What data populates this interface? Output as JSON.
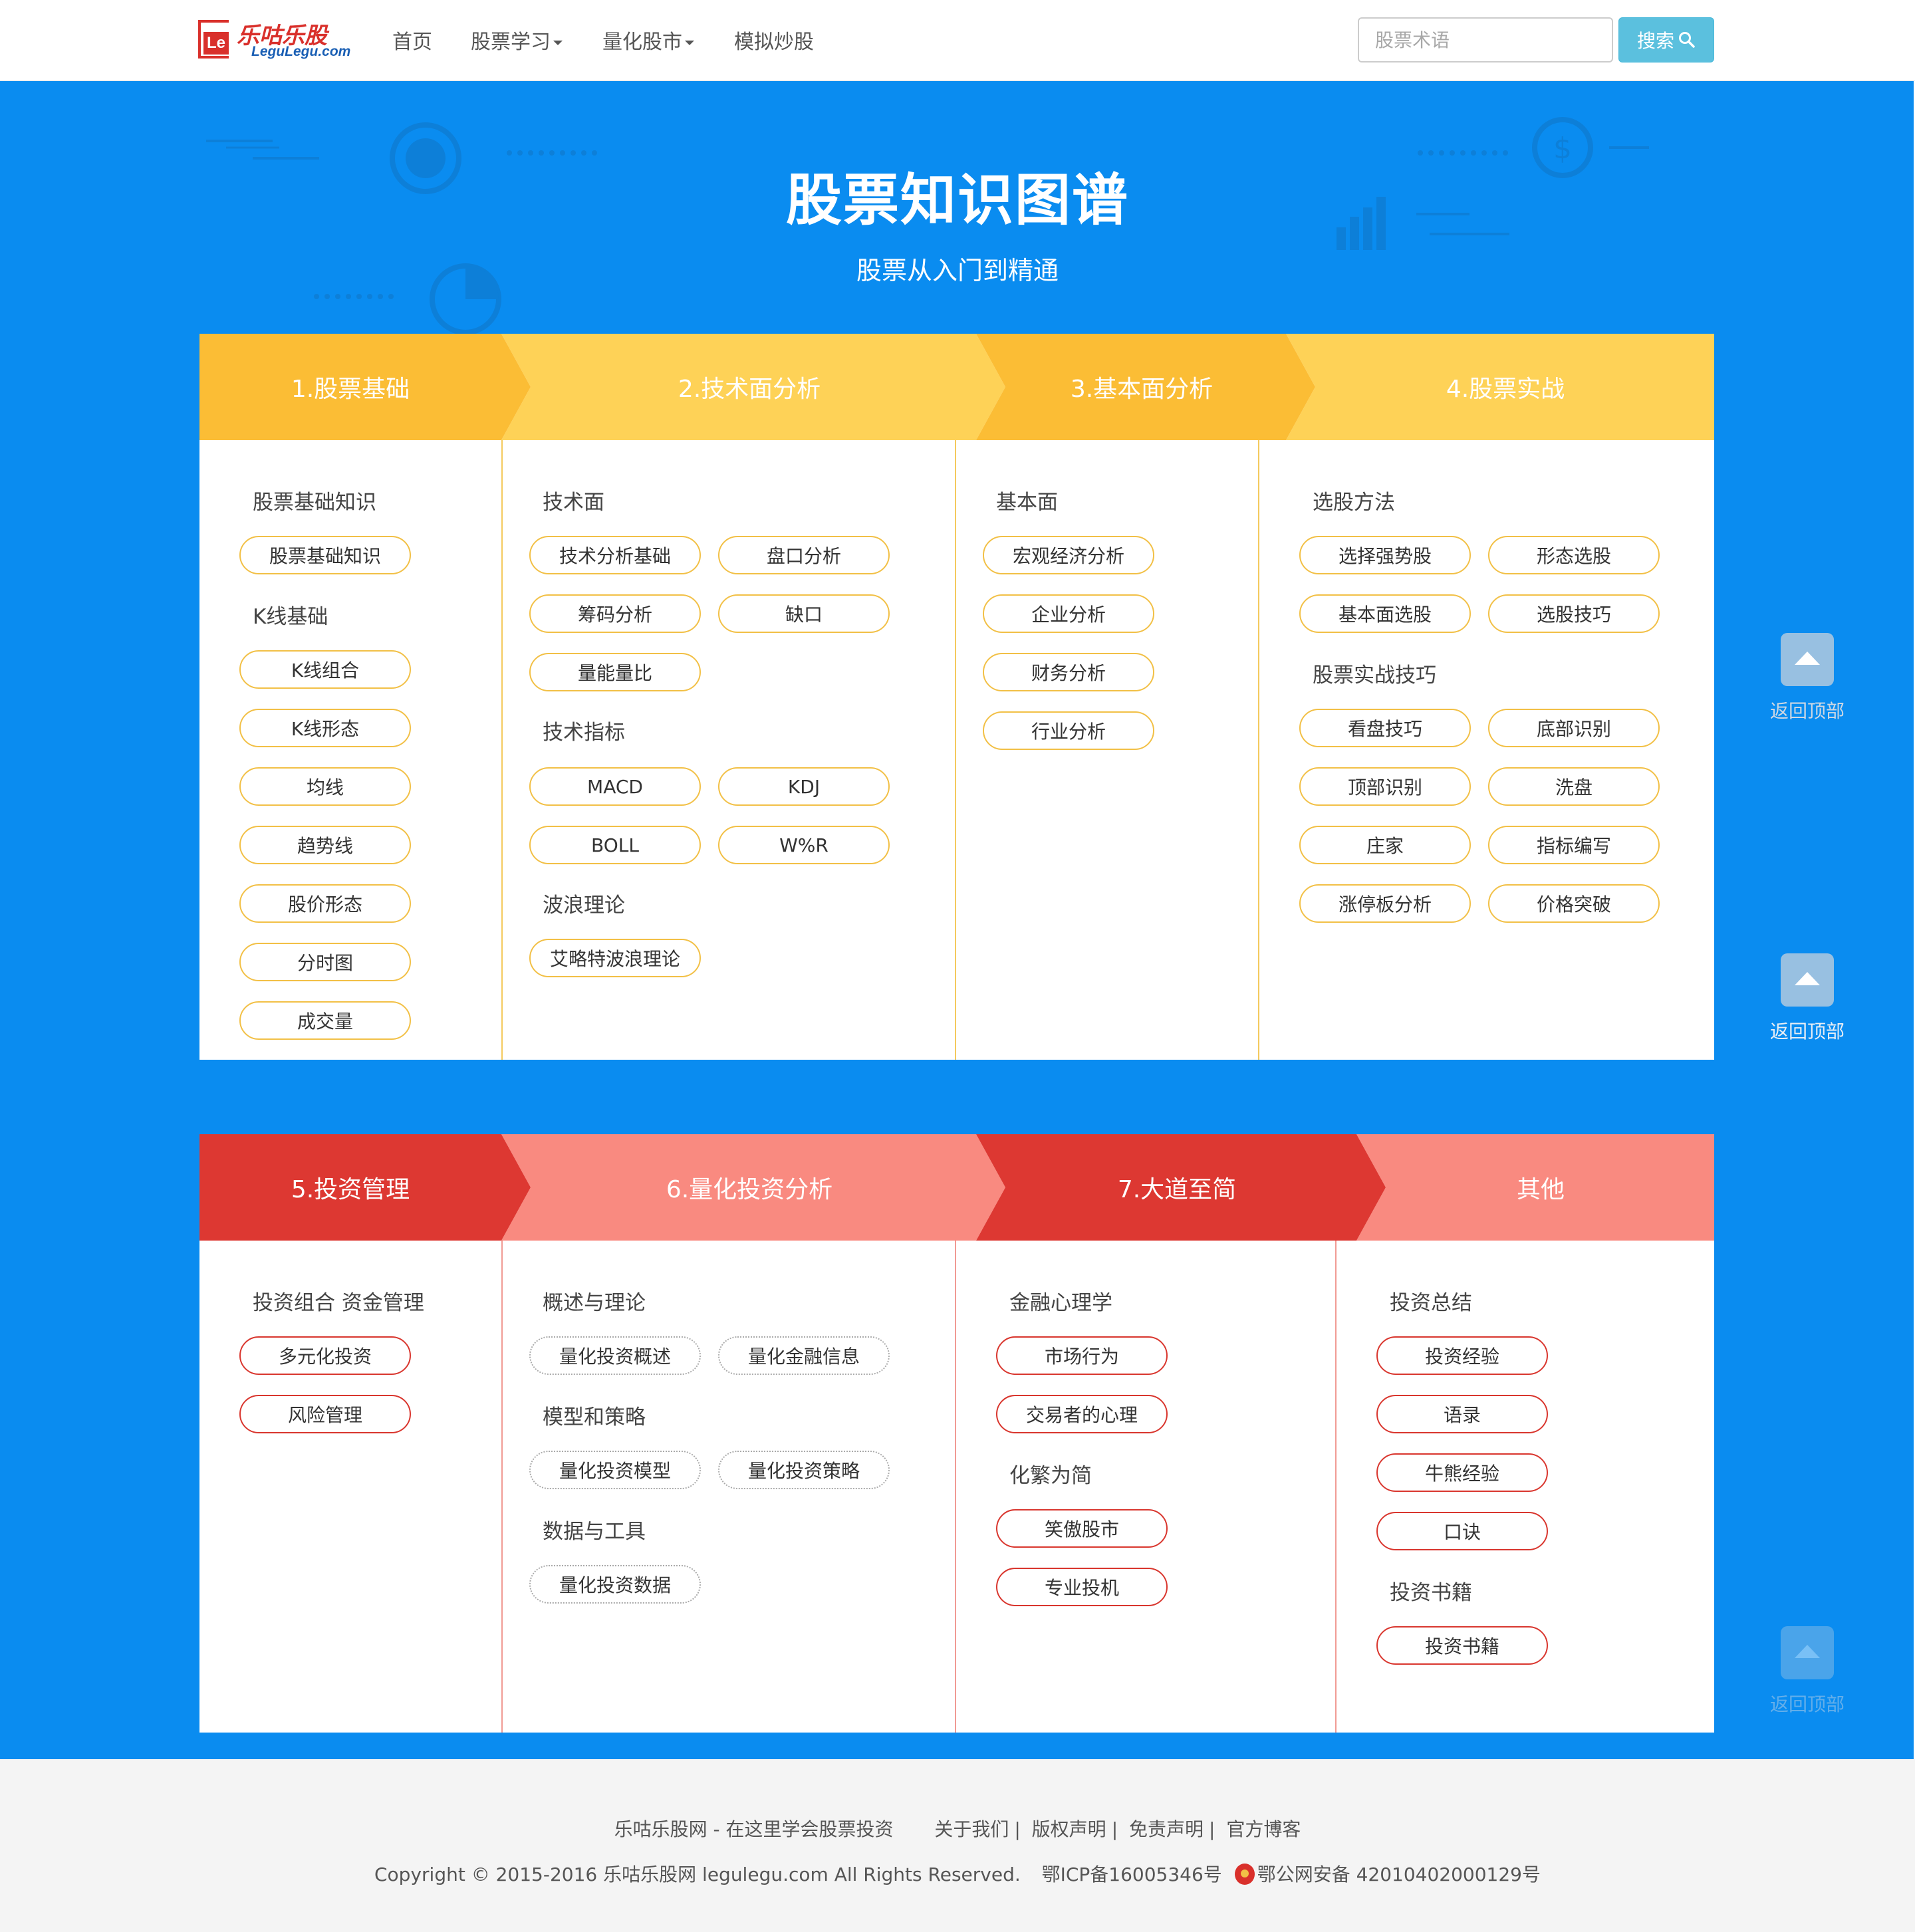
{
  "nav": {
    "logo_title": "乐咕乐股",
    "logo_sub": "LeguLegu.com",
    "logo_mark": "Le",
    "items": [
      {
        "label": "首页",
        "dropdown": false
      },
      {
        "label": "股票学习",
        "dropdown": true
      },
      {
        "label": "量化股市",
        "dropdown": true
      },
      {
        "label": "模拟炒股",
        "dropdown": false
      }
    ],
    "search_placeholder": "股票术语",
    "search_button": "搜索"
  },
  "hero": {
    "title": "股票知识图谱",
    "subtitle": "股票从入门到精通"
  },
  "section1": {
    "headers": [
      "1.股票基础",
      "2.技术面分析",
      "3.基本面分析",
      "4.股票实战"
    ],
    "col1": {
      "cats": [
        "股票基础知识",
        "K线基础"
      ],
      "pills": [
        "股票基础知识",
        "K线组合",
        "K线形态",
        "均线",
        "趋势线",
        "股价形态",
        "分时图",
        "成交量"
      ]
    },
    "col2": {
      "cats": [
        "技术面",
        "技术指标",
        "波浪理论"
      ],
      "pills": [
        "技术分析基础",
        "盘口分析",
        "筹码分析",
        "缺口",
        "量能量比",
        "MACD",
        "KDJ",
        "BOLL",
        "W%R",
        "艾略特波浪理论"
      ]
    },
    "col3": {
      "cats": [
        "基本面"
      ],
      "pills": [
        "宏观经济分析",
        "企业分析",
        "财务分析",
        "行业分析"
      ]
    },
    "col4": {
      "cats": [
        "选股方法",
        "股票实战技巧"
      ],
      "pills": [
        "选择强势股",
        "形态选股",
        "基本面选股",
        "选股技巧",
        "看盘技巧",
        "底部识别",
        "顶部识别",
        "洗盘",
        "庄家",
        "指标编写",
        "涨停板分析",
        "价格突破"
      ]
    }
  },
  "section2": {
    "headers": [
      "5.投资管理",
      "6.量化投资分析",
      "7.大道至简",
      "其他"
    ],
    "col1": {
      "cats": [
        "投资组合 资金管理"
      ],
      "pills": [
        "多元化投资",
        "风险管理"
      ]
    },
    "col2": {
      "cats": [
        "概述与理论",
        "模型和策略",
        "数据与工具"
      ],
      "pills": [
        "量化投资概述",
        "量化金融信息",
        "量化投资模型",
        "量化投资策略",
        "量化投资数据"
      ]
    },
    "col3": {
      "cats": [
        "金融心理学",
        "化繁为简"
      ],
      "pills": [
        "市场行为",
        "交易者的心理",
        "笑傲股市",
        "专业投机"
      ]
    },
    "col4": {
      "cats": [
        "投资总结",
        "投资书籍"
      ],
      "pills": [
        "投资经验",
        "语录",
        "牛熊经验",
        "口诀",
        "投资书籍"
      ]
    }
  },
  "back_to_top": "返回顶部",
  "footer": {
    "site": "乐咕乐股网 - 在这里学会股票投资",
    "links": [
      "关于我们",
      "版权声明",
      "免责声明",
      "官方博客"
    ],
    "copyright": "Copyright © 2015-2016 乐咕乐股网 legulegu.com All Rights Reserved.",
    "icp": "鄂ICP备16005346号",
    "police": "鄂公网安备 42010402000129号"
  },
  "colors": {
    "nav_bg": "#ffffff",
    "hero_bg": "#0a8cf0",
    "yellow_dark": "#fbbd35",
    "yellow_light": "#fed257",
    "red_dark": "#dd3832",
    "red_light": "#f98a80",
    "search_btn": "#5bc0de",
    "logo_red": "#d9302b"
  }
}
